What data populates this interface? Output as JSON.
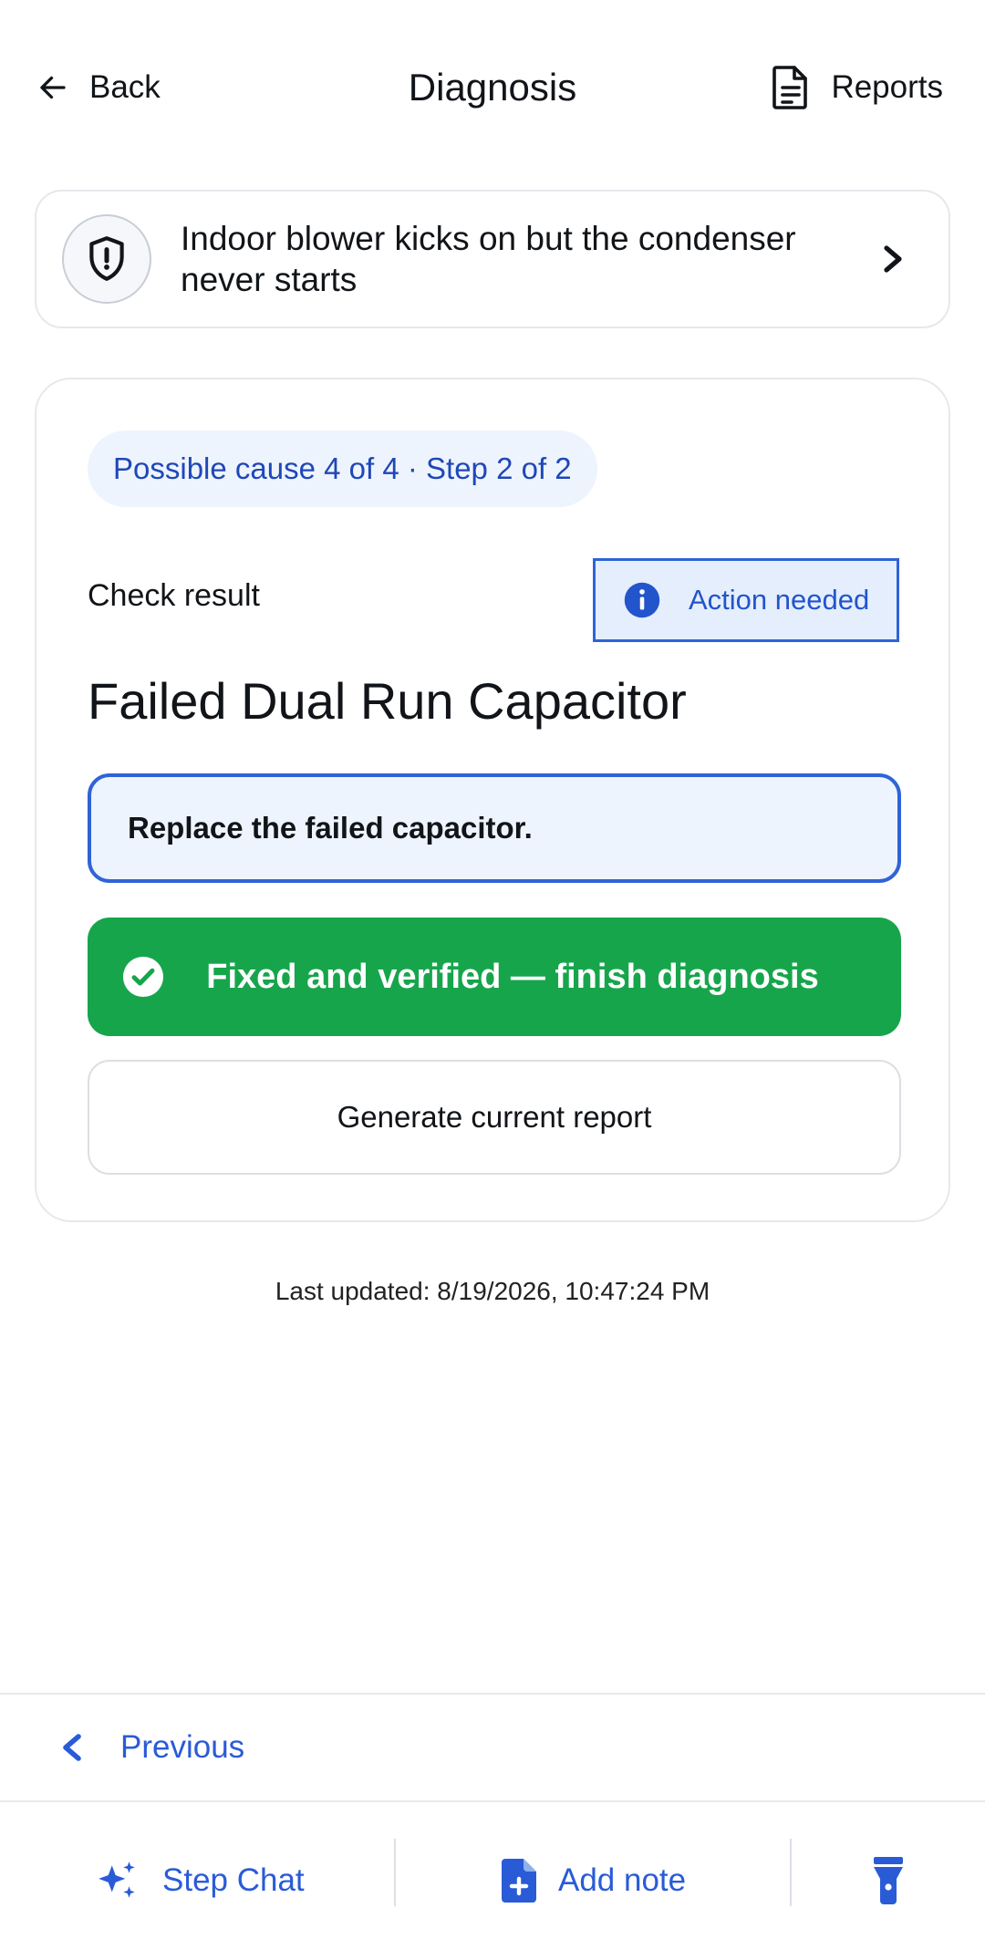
{
  "header": {
    "back_label": "Back",
    "title": "Diagnosis",
    "reports_label": "Reports"
  },
  "problem": {
    "text": "Indoor blower kicks on but the condenser never starts",
    "icon": "shield-alert-icon"
  },
  "card": {
    "step_pill": "Possible cause 4 of 4 · Step 2 of 2",
    "check_result_label": "Check result",
    "status_badge": "Action needed",
    "cause_title": "Failed Dual Run Capacitor",
    "instruction": "Replace the failed capacitor.",
    "finish_label": "Fixed and verified — finish diagnosis",
    "report_label": "Generate current report"
  },
  "last_updated": "Last updated: 8/19/2026, 10:47:24 PM",
  "footer": {
    "previous_label": "Previous",
    "step_chat_label": "Step Chat",
    "add_note_label": "Add note",
    "flashlight_icon": "flashlight-icon"
  },
  "colors": {
    "accent": "#2a5bd7",
    "success": "#17a54c",
    "pill_bg": "#eef4fd"
  }
}
